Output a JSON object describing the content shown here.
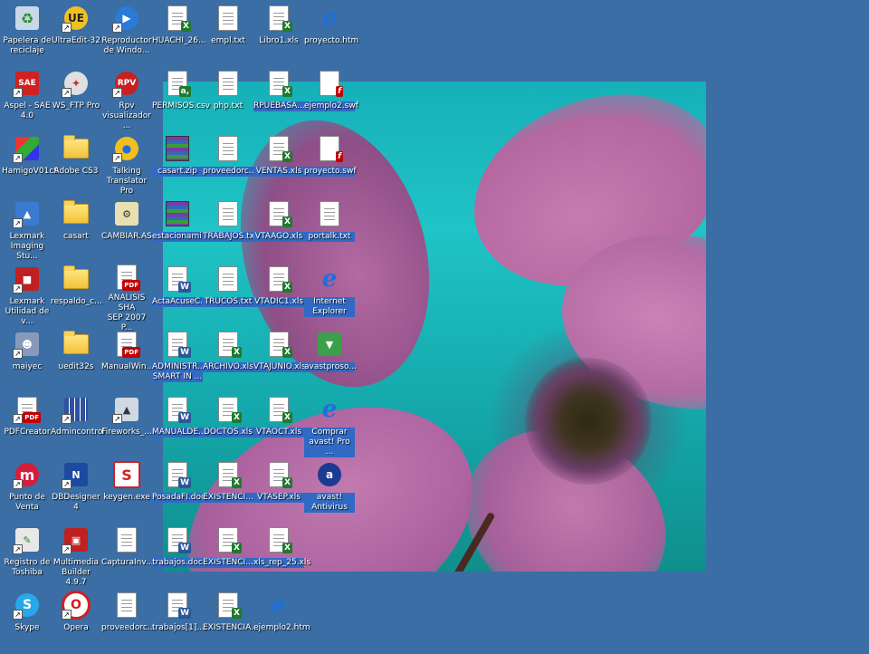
{
  "desktop": {
    "icons": [
      {
        "label": "Papelera de\nreciclaje",
        "icon": "recycle-bin-icon",
        "selected": false
      },
      {
        "label": "UltraEdit-32",
        "icon": "ultraedit-icon",
        "selected": false
      },
      {
        "label": "Reproductor\nde Windo...",
        "icon": "media-player-icon",
        "selected": false
      },
      {
        "label": "HUACHI_26...",
        "icon": "excel-icon",
        "selected": false
      },
      {
        "label": "empl.txt",
        "icon": "text-file-icon",
        "selected": false
      },
      {
        "label": "Libro1.xls",
        "icon": "excel-icon",
        "selected": false
      },
      {
        "label": "proyecto.htm",
        "icon": "html-file-icon",
        "selected": false
      },
      {
        "label": "Aspel - SAE\n4.0",
        "icon": "sae-icon",
        "selected": false
      },
      {
        "label": "WS_FTP Pro",
        "icon": "ftp-icon",
        "selected": false
      },
      {
        "label": "Rpv\nvisualizador ...",
        "icon": "rpv-icon",
        "selected": false
      },
      {
        "label": "PERMISOS.csv",
        "icon": "csv-icon",
        "selected": false
      },
      {
        "label": "php.txt",
        "icon": "text-file-icon",
        "selected": false
      },
      {
        "label": "RPUEBASA...",
        "icon": "excel-icon",
        "selected": true
      },
      {
        "label": "ejemplo2.swf",
        "icon": "flash-file-icon",
        "selected": true
      },
      {
        "label": "HamigoV01c9",
        "icon": "rubik-cube-icon",
        "selected": false
      },
      {
        "label": "Adobe CS3",
        "icon": "folder-icon",
        "selected": false
      },
      {
        "label": "Talking\nTranslator Pro",
        "icon": "globe-icon",
        "selected": false
      },
      {
        "label": "casart.zip",
        "icon": "zip-icon",
        "selected": true
      },
      {
        "label": "proveedorc...",
        "icon": "text-file-icon",
        "selected": true
      },
      {
        "label": "VENTAS.xls",
        "icon": "excel-icon",
        "selected": true
      },
      {
        "label": "proyecto.swf",
        "icon": "flash-file-icon",
        "selected": true
      },
      {
        "label": "Lexmark\nImaging Stu...",
        "icon": "lexmark-icon",
        "selected": false
      },
      {
        "label": "casart",
        "icon": "folder-icon",
        "selected": false
      },
      {
        "label": "CAMBIAR.ASP",
        "icon": "asp-file-icon",
        "selected": false
      },
      {
        "label": "estacionami...",
        "icon": "zip-icon",
        "selected": true
      },
      {
        "label": "TRABAJOS.txt",
        "icon": "text-file-icon",
        "selected": true
      },
      {
        "label": "VTAAGO.xls",
        "icon": "excel-icon",
        "selected": true
      },
      {
        "label": "portalk.txt",
        "icon": "text-file-icon",
        "selected": true
      },
      {
        "label": "Lexmark\nUtilidad de v...",
        "icon": "lexmark-utility-icon",
        "selected": false
      },
      {
        "label": "respaldo_c...",
        "icon": "folder-icon",
        "selected": false
      },
      {
        "label": "ANALISIS SHA\nSEP 2007 P...",
        "icon": "pdf-icon",
        "selected": false
      },
      {
        "label": "ActaAcuseC...",
        "icon": "word-icon",
        "selected": true
      },
      {
        "label": "TRUCOS.txt",
        "icon": "text-file-icon",
        "selected": true
      },
      {
        "label": "VTADIC1.xls",
        "icon": "excel-icon",
        "selected": true
      },
      {
        "label": "Internet\nExplorer",
        "icon": "internet-explorer-icon",
        "selected": true
      },
      {
        "label": "maiyec",
        "icon": "computer-user-icon",
        "selected": false
      },
      {
        "label": "uedit32s",
        "icon": "folder-icon",
        "selected": false
      },
      {
        "label": "ManualWin...",
        "icon": "pdf-icon",
        "selected": false
      },
      {
        "label": "ADMINISTR...\nSMART IN ...",
        "icon": "word-icon",
        "selected": true
      },
      {
        "label": "ARCHIVO.xls",
        "icon": "excel-icon",
        "selected": true
      },
      {
        "label": "VTAJUNIO.xls",
        "icon": "excel-icon",
        "selected": true
      },
      {
        "label": "avastproso...",
        "icon": "installer-icon",
        "selected": true
      },
      {
        "label": "PDFCreator",
        "icon": "pdf-creator-icon",
        "selected": false
      },
      {
        "label": "Admincontrol",
        "icon": "calendar-grid-icon",
        "selected": false
      },
      {
        "label": "Fireworks_...",
        "icon": "fireworks-icon",
        "selected": false
      },
      {
        "label": "MANUALDE...",
        "icon": "word-icon",
        "selected": true
      },
      {
        "label": "DOCTOS.xls",
        "icon": "excel-icon",
        "selected": true
      },
      {
        "label": "VTAOCT.xls",
        "icon": "excel-icon",
        "selected": true
      },
      {
        "label": "Comprar\navast! Pro ...",
        "icon": "html-file-icon",
        "selected": true
      },
      {
        "label": "Punto de\nVenta",
        "icon": "punto-venta-icon",
        "selected": false
      },
      {
        "label": "DBDesigner 4",
        "icon": "dbdesigner-icon",
        "selected": false
      },
      {
        "label": "keygen.exe",
        "icon": "keygen-icon",
        "selected": false
      },
      {
        "label": "PosadaFI.doc",
        "icon": "word-icon",
        "selected": true
      },
      {
        "label": "EXISTENCI...",
        "icon": "excel-icon",
        "selected": true
      },
      {
        "label": "VTASEP.xls",
        "icon": "excel-icon",
        "selected": true
      },
      {
        "label": "avast!\nAntivirus",
        "icon": "avast-icon",
        "selected": true
      },
      {
        "label": "Registro de\nToshiba",
        "icon": "toshiba-registration-icon",
        "selected": false
      },
      {
        "label": "Multimedia\nBuilder 4.9.7",
        "icon": "multimedia-builder-icon",
        "selected": false
      },
      {
        "label": "CapturaInv...",
        "icon": "document-icon",
        "selected": false
      },
      {
        "label": "trabajos.doc",
        "icon": "word-icon",
        "selected": true
      },
      {
        "label": "EXISTENCI...",
        "icon": "excel-icon",
        "selected": true
      },
      {
        "label": "xls_rep_25.xls",
        "icon": "excel-icon",
        "selected": true
      },
      {
        "label": "Skype",
        "icon": "skype-icon",
        "selected": false
      },
      {
        "label": "Opera",
        "icon": "opera-icon",
        "selected": false
      },
      {
        "label": "proveedorc...",
        "icon": "document-icon",
        "selected": false
      },
      {
        "label": "trabajos[1]....",
        "icon": "word-icon",
        "selected": false
      },
      {
        "label": "EXISTENCIA...",
        "icon": "excel-icon",
        "selected": false
      },
      {
        "label": "ejemplo2.htm",
        "icon": "html-file-icon",
        "selected": false
      }
    ]
  }
}
